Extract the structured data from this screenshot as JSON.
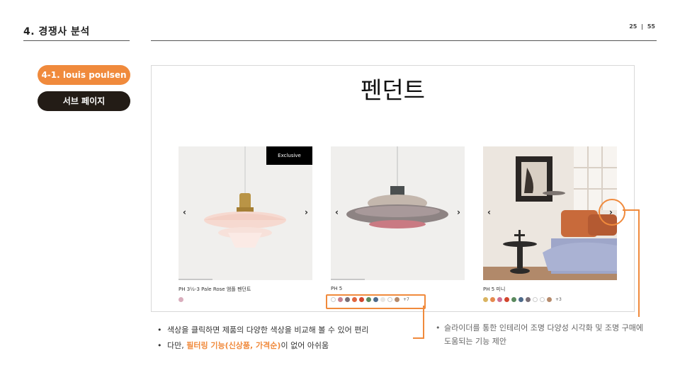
{
  "header": {
    "section_title": "4. 경쟁사 분석",
    "page_current": "25",
    "page_sep": "|",
    "page_total": "55"
  },
  "tabs": {
    "active": "4-1. louis poulsen",
    "secondary": "서브 페이지"
  },
  "panel": {
    "title": "펜던트"
  },
  "products": [
    {
      "name": "PH 3½-3 Pale Rose 앰플 펜던트",
      "badge": "Exclusive",
      "swatches": [
        "#d9aebd"
      ],
      "more": ""
    },
    {
      "name": "PH 5",
      "badge": "",
      "swatches": [
        "#ffffff",
        "#c7808d",
        "#7a6f76",
        "#e0663f",
        "#d2452d",
        "#5a8a5e",
        "#4d6a8a",
        "#e9e7e4",
        "#ffffff",
        "#b58a6b"
      ],
      "more": "+7"
    },
    {
      "name": "PH 5 미니",
      "badge": "",
      "swatches": [
        "#d9b461",
        "#e58a4f",
        "#cf6f93",
        "#d2452d",
        "#5a8a5e",
        "#4d6a8a",
        "#7a6f76",
        "#ffffff",
        "#ffffff",
        "#b58a6b"
      ],
      "more": "+3"
    }
  ],
  "arrows": {
    "prev": "‹",
    "next": "›"
  },
  "notes": {
    "line1": "색상을 클릭하면 제품의 다양한 색상을 비교해 볼 수 있어 편리",
    "line2_pre": "다만, ",
    "line2_hl": "필터링 기능(신상품, 가격순)",
    "line2_post": "이 없어 아쉬움"
  },
  "note2": {
    "bullet": "•",
    "text": "슬라이더를 통한 인테리어 조명 다양성 시각화 및 조명 구매에 도움되는 기능 제안"
  },
  "colors": {
    "accent": "#f08a3c",
    "dark_pill": "#231c16"
  }
}
